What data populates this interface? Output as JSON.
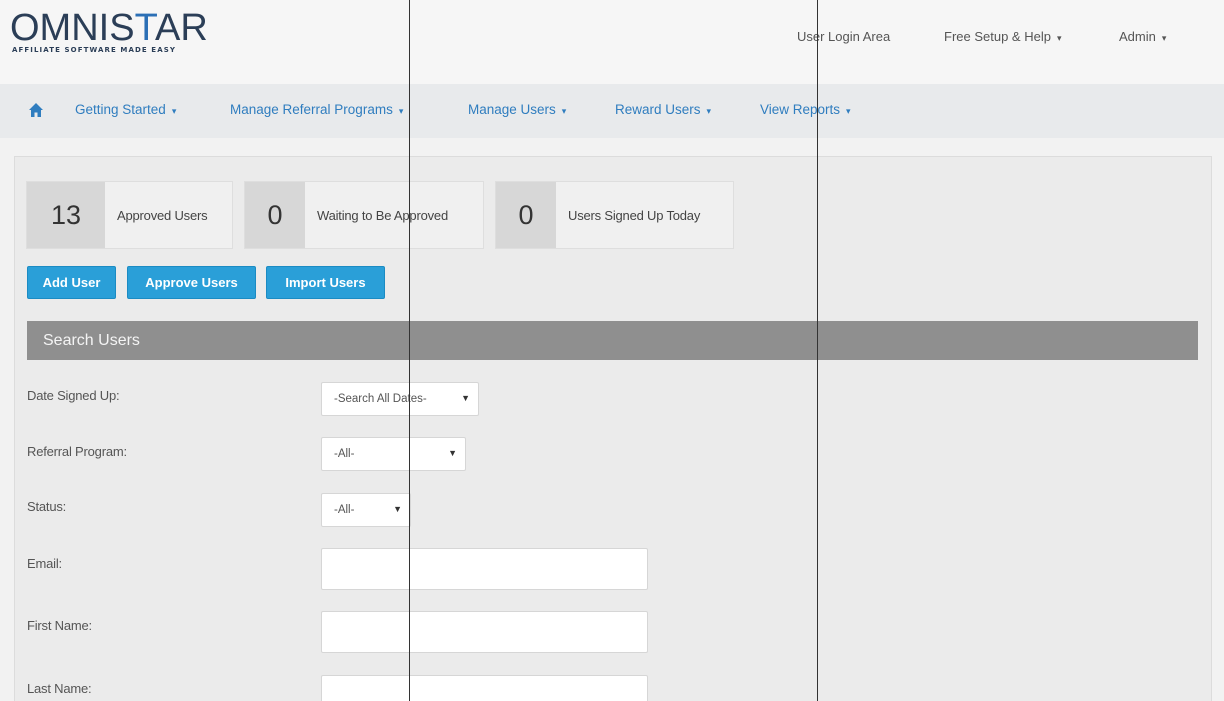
{
  "brand": {
    "name_left": "OMNIS",
    "name_star": "T",
    "name_right": "AR",
    "tagline": "AFFILIATE SOFTWARE MADE EASY"
  },
  "top_links": {
    "login": "User Login Area",
    "help": "Free Setup & Help",
    "admin": "Admin"
  },
  "nav": {
    "items": [
      "Getting Started",
      "Manage Referral Programs",
      "Manage Users",
      "Reward Users",
      "View Reports"
    ]
  },
  "stats": [
    {
      "value": "13",
      "label": "Approved Users"
    },
    {
      "value": "0",
      "label": "Waiting to Be Approved"
    },
    {
      "value": "0",
      "label": "Users Signed Up Today"
    }
  ],
  "buttons": {
    "add": "Add User",
    "approve": "Approve Users",
    "import": "Import Users"
  },
  "search": {
    "title": "Search Users",
    "date_label": "Date Signed Up:",
    "date_value": "-Search All Dates-",
    "program_label": "Referral Program:",
    "program_value": "-All-",
    "status_label": "Status:",
    "status_value": "-All-",
    "email_label": "Email:",
    "first_label": "First Name:",
    "last_label": "Last Name:"
  },
  "colors": {
    "accent": "#2a9fd8",
    "nav_link": "#2f7dbf",
    "section_bar": "#8f8f8f"
  }
}
